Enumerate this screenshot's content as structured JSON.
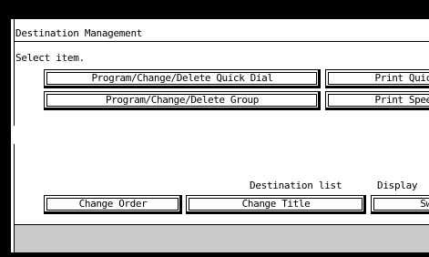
{
  "window": {
    "title": "Destination Management",
    "subtitle": "Select item."
  },
  "buttons": {
    "program_quick_dial": "Program/Change/Delete Quick Dial",
    "program_group": "Program/Change/Delete Group",
    "print_quick": "Print Quick",
    "print_speed": "Print Speed",
    "change_order": "Change Order",
    "change_title": "Change Title",
    "switch": "Swi"
  },
  "labels": {
    "destination_list": "Destination list",
    "display": "Display"
  }
}
